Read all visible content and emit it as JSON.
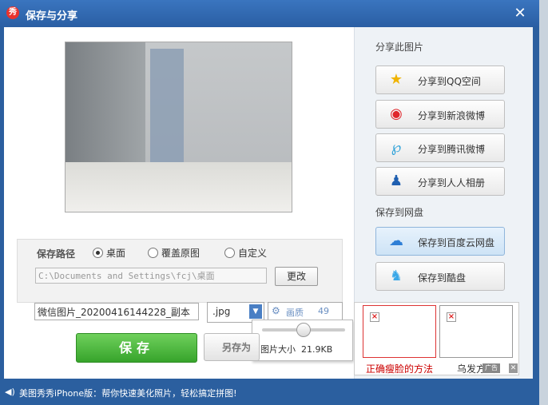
{
  "window": {
    "title": "保存与分享",
    "close": "✕",
    "logo": "秀"
  },
  "preview": {
    "alt": ""
  },
  "save_path": {
    "label": "保存路径",
    "options": [
      {
        "label": "桌面",
        "checked": true
      },
      {
        "label": "覆盖原图",
        "checked": false
      },
      {
        "label": "自定义",
        "checked": false
      }
    ],
    "path": "C:\\Documents and Settings\\fcj\\桌面",
    "change_button": "更改"
  },
  "file": {
    "name": "微信图片_20200416144228_副本",
    "ext": ".jpg",
    "quality_label": "画质",
    "quality_value": "49",
    "quality_level": 0.49,
    "size_label": "图片大小",
    "size_value": "21.9KB"
  },
  "buttons": {
    "save": "保存",
    "save_as": "另存为"
  },
  "share": {
    "title": "分享此图片",
    "items": [
      {
        "label": "分享到QQ空间",
        "icon": "star-icon"
      },
      {
        "label": "分享到新浪微博",
        "icon": "weibo-icon"
      },
      {
        "label": "分享到腾讯微博",
        "icon": "tencent-weibo-icon"
      },
      {
        "label": "分享到人人相册",
        "icon": "renren-icon"
      }
    ]
  },
  "cloud": {
    "title": "保存到网盘",
    "items": [
      {
        "label": "保存到百度云网盘",
        "icon": "baidu-cloud-icon",
        "selected": true
      },
      {
        "label": "保存到酷盘",
        "icon": "kupan-icon",
        "selected": false
      }
    ]
  },
  "ads": {
    "items": [
      {
        "caption": "正确瘦脸的方法"
      },
      {
        "caption": "乌发方法"
      }
    ],
    "tag": "广告",
    "close": "✕"
  },
  "status": {
    "text": "美图秀秀iPhone版：帮你快速美化照片，轻松搞定拼图!"
  },
  "colors": {
    "title_bar": "#2b5f9f",
    "save_green": "#37a42b",
    "selected_blue": "#cde3f6"
  }
}
